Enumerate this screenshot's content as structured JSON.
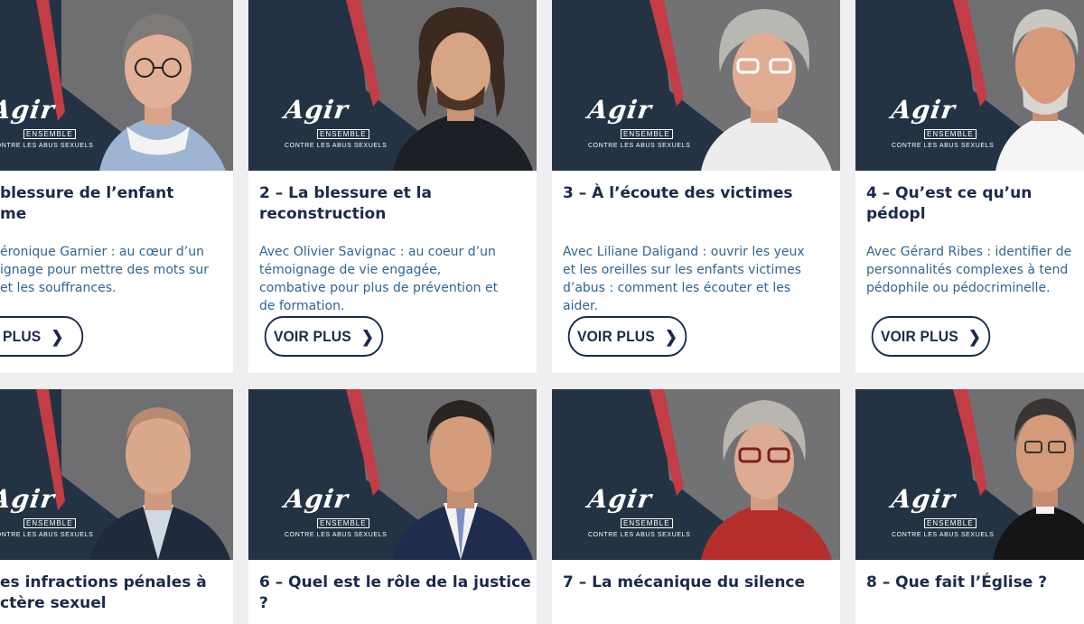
{
  "colors": {
    "navy": "#233343",
    "red": "#c23d46",
    "pink": "#f2d8cf",
    "title": "#1b2a4a",
    "desc": "#2f6596"
  },
  "logo": {
    "agir": "Agir",
    "ensemble": "ENSEMBLE",
    "sub": "CONTRE LES ABUS SEXUELS"
  },
  "button_label": "VOIR PLUS",
  "cards": [
    {
      "title": "blessure de l’enfant\nme",
      "description": "éronique Garnier : au cœur d’un\nignage pour mettre des mots sur\net les souffrances.",
      "button": "IR PLUS"
    },
    {
      "title": "2 – La blessure et la\nreconstruction",
      "description": "Avec Olivier Savignac : au coeur d’un\ntémoignage de vie engagée,\ncombative pour plus de prévention et\nde formation.",
      "button": "VOIR PLUS"
    },
    {
      "title": "3 – À l’écoute des victimes",
      "description": "Avec Liliane Daligand : ouvrir les yeux\net les oreilles sur les enfants victimes\nd’abus : comment les écouter et les\naider.",
      "button": "VOIR PLUS"
    },
    {
      "title": "4 – Qu’est ce qu’un pédopl",
      "description": "Avec Gérard Ribes : identifier de\npersonnalités complexes à tend\npédophile ou pédocriminelle.",
      "button": "VOIR PLUS"
    },
    {
      "title": "es infractions pénales à\nctère sexuel"
    },
    {
      "title": "6 – Quel est le rôle de la justice\n?"
    },
    {
      "title": "7 – La mécanique du silence"
    },
    {
      "title": "8 – Que fait l’Église ?"
    }
  ]
}
